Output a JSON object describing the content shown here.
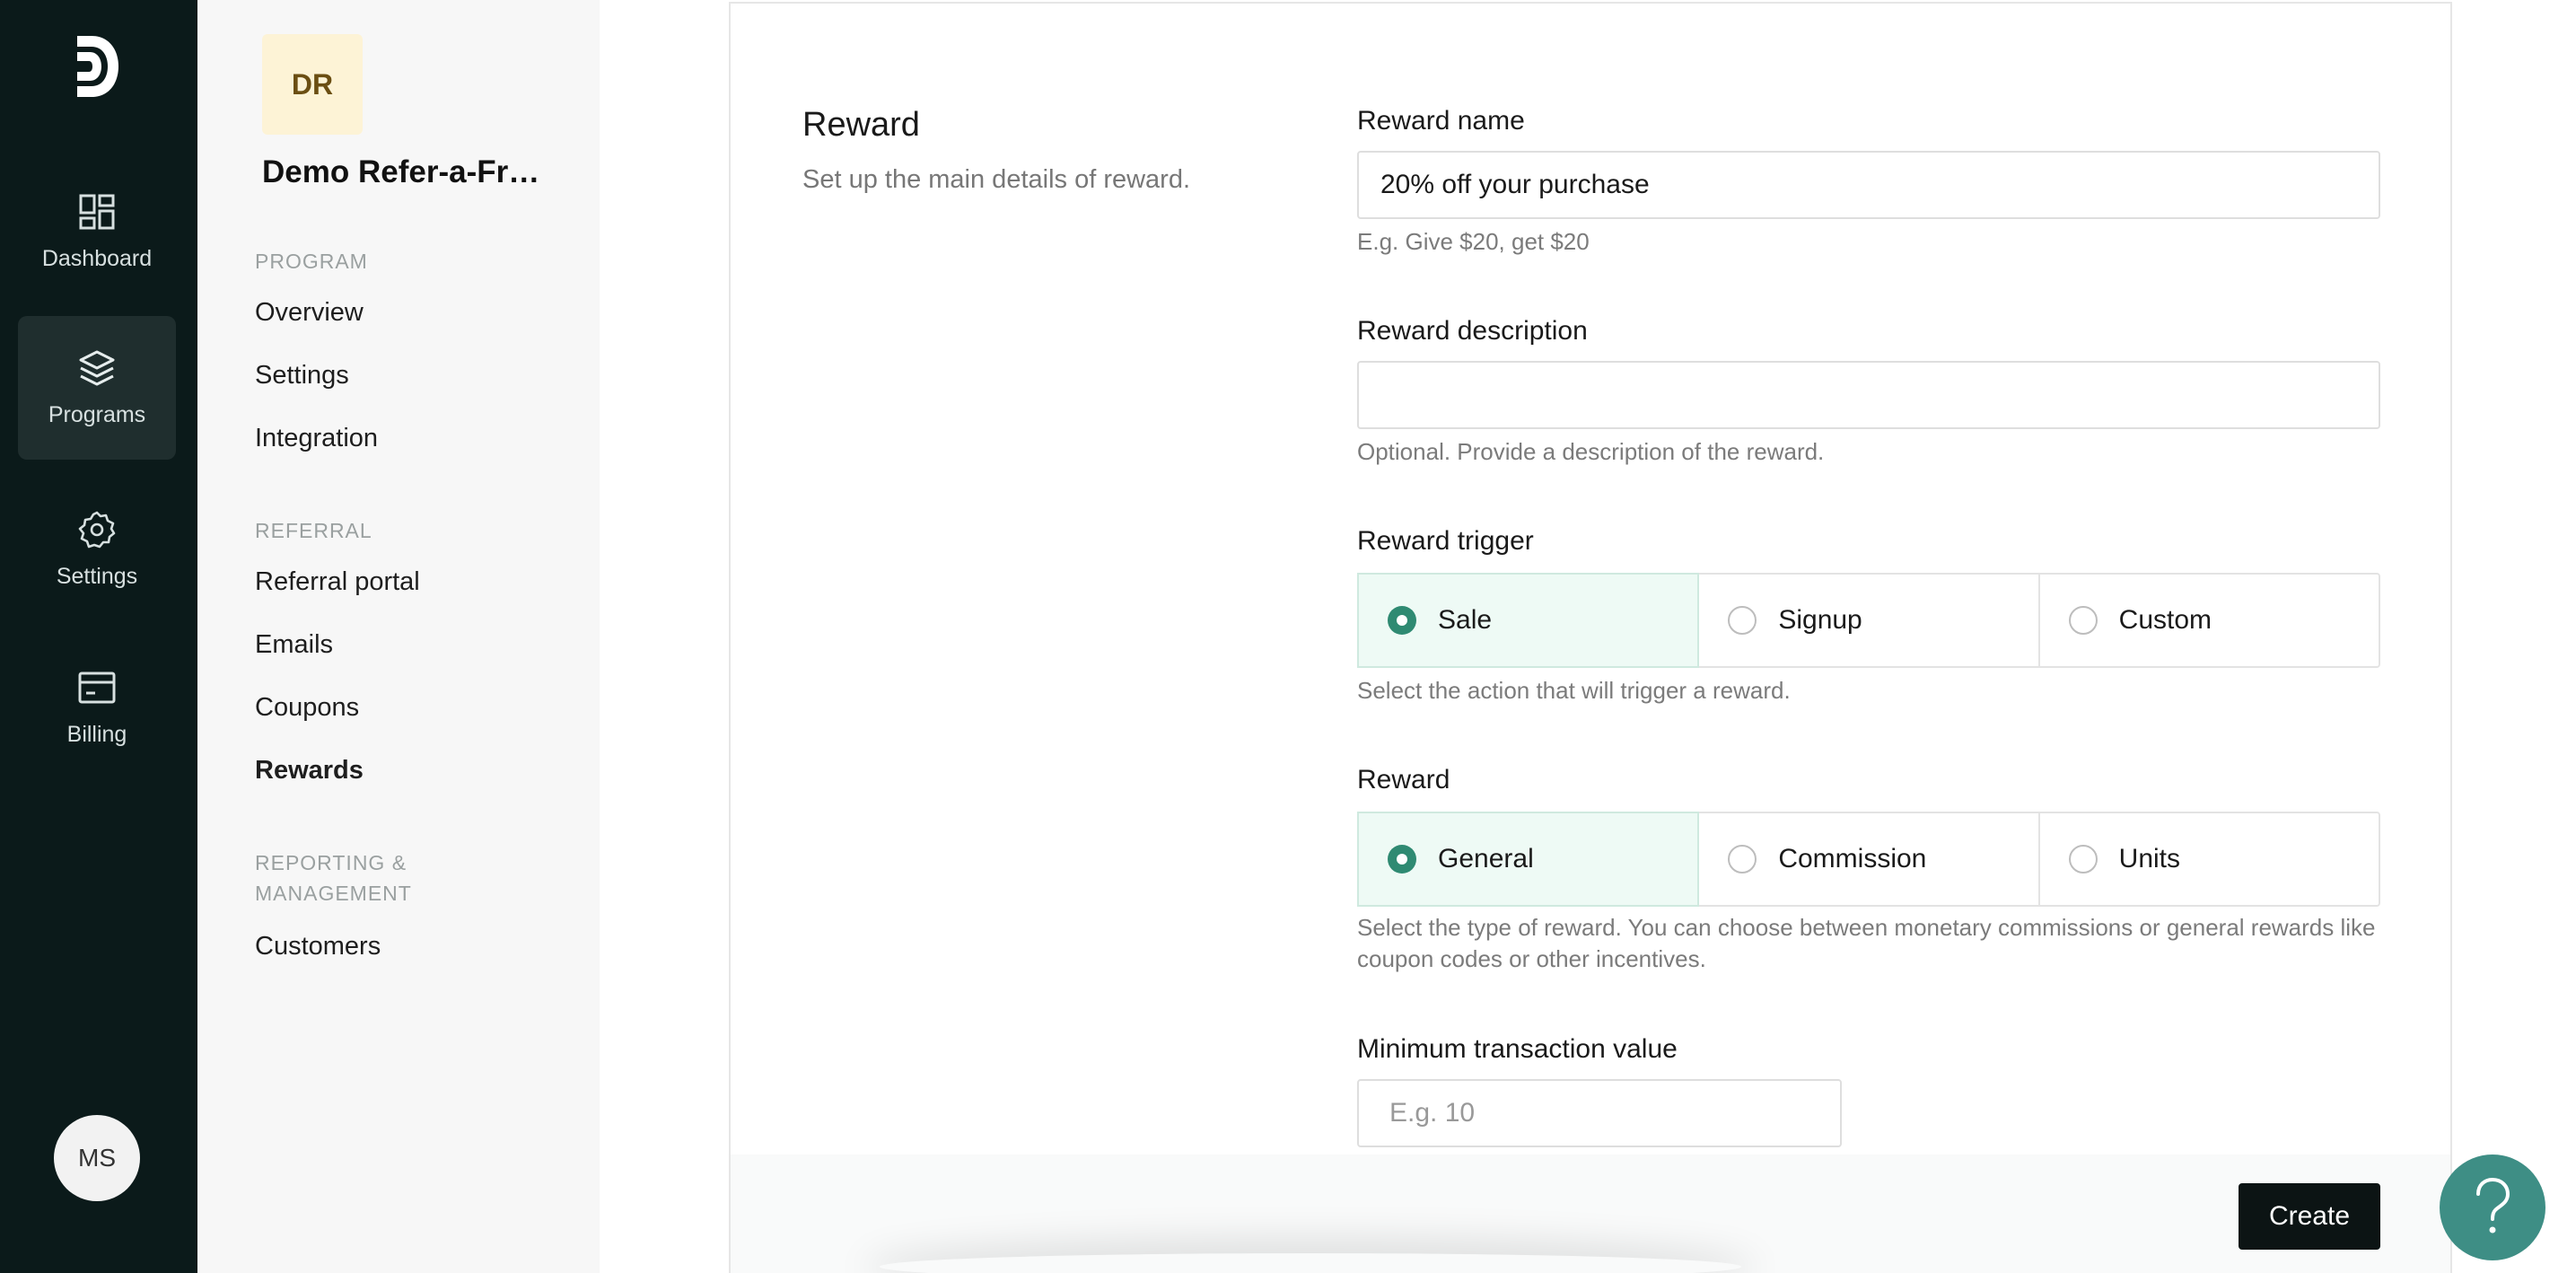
{
  "rail": {
    "items": [
      {
        "label": "Dashboard",
        "icon": "dashboard-icon"
      },
      {
        "label": "Programs",
        "icon": "layers-icon",
        "active": true
      },
      {
        "label": "Settings",
        "icon": "gear-icon"
      },
      {
        "label": "Billing",
        "icon": "billing-icon"
      }
    ],
    "user_initials": "MS"
  },
  "subnav": {
    "program_initials": "DR",
    "program_name": "Demo Refer-a-Friend",
    "sections": [
      {
        "heading": "PROGRAM",
        "links": [
          "Overview",
          "Settings",
          "Integration"
        ]
      },
      {
        "heading": "REFERRAL",
        "links": [
          "Referral portal",
          "Emails",
          "Coupons",
          "Rewards"
        ]
      },
      {
        "heading": "REPORTING & MANAGEMENT",
        "links": [
          "Customers"
        ]
      }
    ],
    "active_link": "Rewards"
  },
  "section": {
    "title": "Reward",
    "description": "Set up the main details of reward."
  },
  "form": {
    "reward_name": {
      "label": "Reward name",
      "value": "20% off your purchase",
      "help": "E.g. Give $20, get $20"
    },
    "reward_description": {
      "label": "Reward description",
      "value": "",
      "help": "Optional. Provide a description of the reward."
    },
    "reward_trigger": {
      "label": "Reward trigger",
      "options": [
        "Sale",
        "Signup",
        "Custom"
      ],
      "selected": "Sale",
      "help": "Select the action that will trigger a reward."
    },
    "reward_type": {
      "label": "Reward",
      "options": [
        "General",
        "Commission",
        "Units"
      ],
      "selected": "General",
      "help": "Select the type of reward. You can choose between monetary commissions or general rewards like coupon codes or other incentives."
    },
    "min_transaction": {
      "label": "Minimum transaction value",
      "placeholder": "E.g. 10"
    }
  },
  "footer": {
    "create_label": "Create"
  },
  "colors": {
    "rail_bg": "#0b1a1a",
    "accent_green": "#2f8a72",
    "help_fab": "#3e8e85"
  }
}
